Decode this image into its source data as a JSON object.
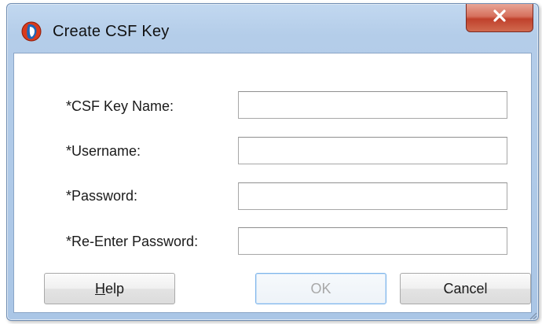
{
  "dialog": {
    "title": "Create CSF Key",
    "icon": "oracle-jdeveloper-icon",
    "close_icon": "close-icon"
  },
  "form": {
    "fields": [
      {
        "label": "*CSF Key Name:",
        "value": "",
        "name": "csf-key-name"
      },
      {
        "label": "*Username:",
        "value": "",
        "name": "username"
      },
      {
        "label": "*Password:",
        "value": "",
        "name": "password"
      },
      {
        "label": "*Re-Enter Password:",
        "value": "",
        "name": "re-enter-password"
      }
    ]
  },
  "buttons": {
    "help_mnemonic": "H",
    "help_rest": "elp",
    "ok_label": "OK",
    "cancel_label": "Cancel"
  },
  "colors": {
    "title_bar": "#b4cde9",
    "close_button": "#c0412c",
    "ok_border": "#7eb4ea"
  }
}
